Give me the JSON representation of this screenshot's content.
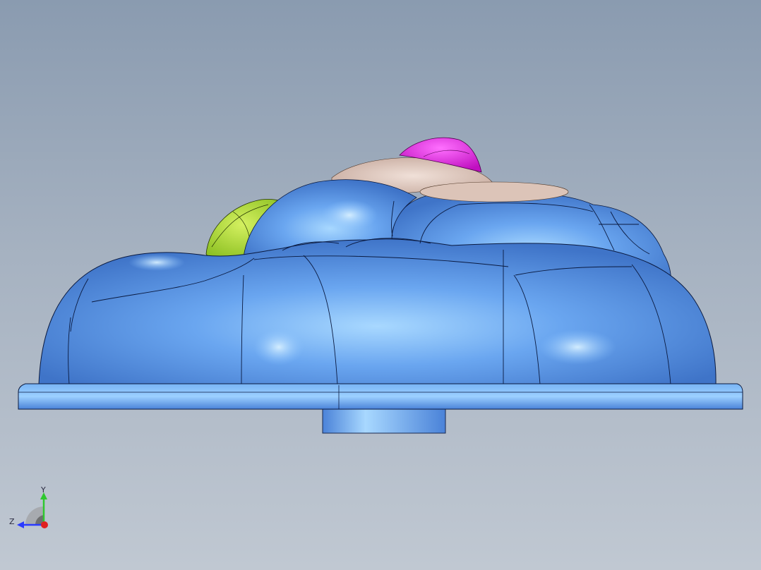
{
  "viewport": {
    "background_top": "#8a9bb0",
    "background_bottom": "#c0c8d2"
  },
  "model": {
    "body_color": "#5c95e6",
    "highlight_color": "#a8d8ff",
    "accent_colors": {
      "green_part": "#a4dc2a",
      "pink_part": "#e020e0",
      "beige_part": "#dcc4b8"
    }
  },
  "triad": {
    "y_label": "Y",
    "z_label": "Z",
    "y_color": "#2ec82e",
    "z_color": "#2a3aff",
    "x_color": "#e02020"
  }
}
